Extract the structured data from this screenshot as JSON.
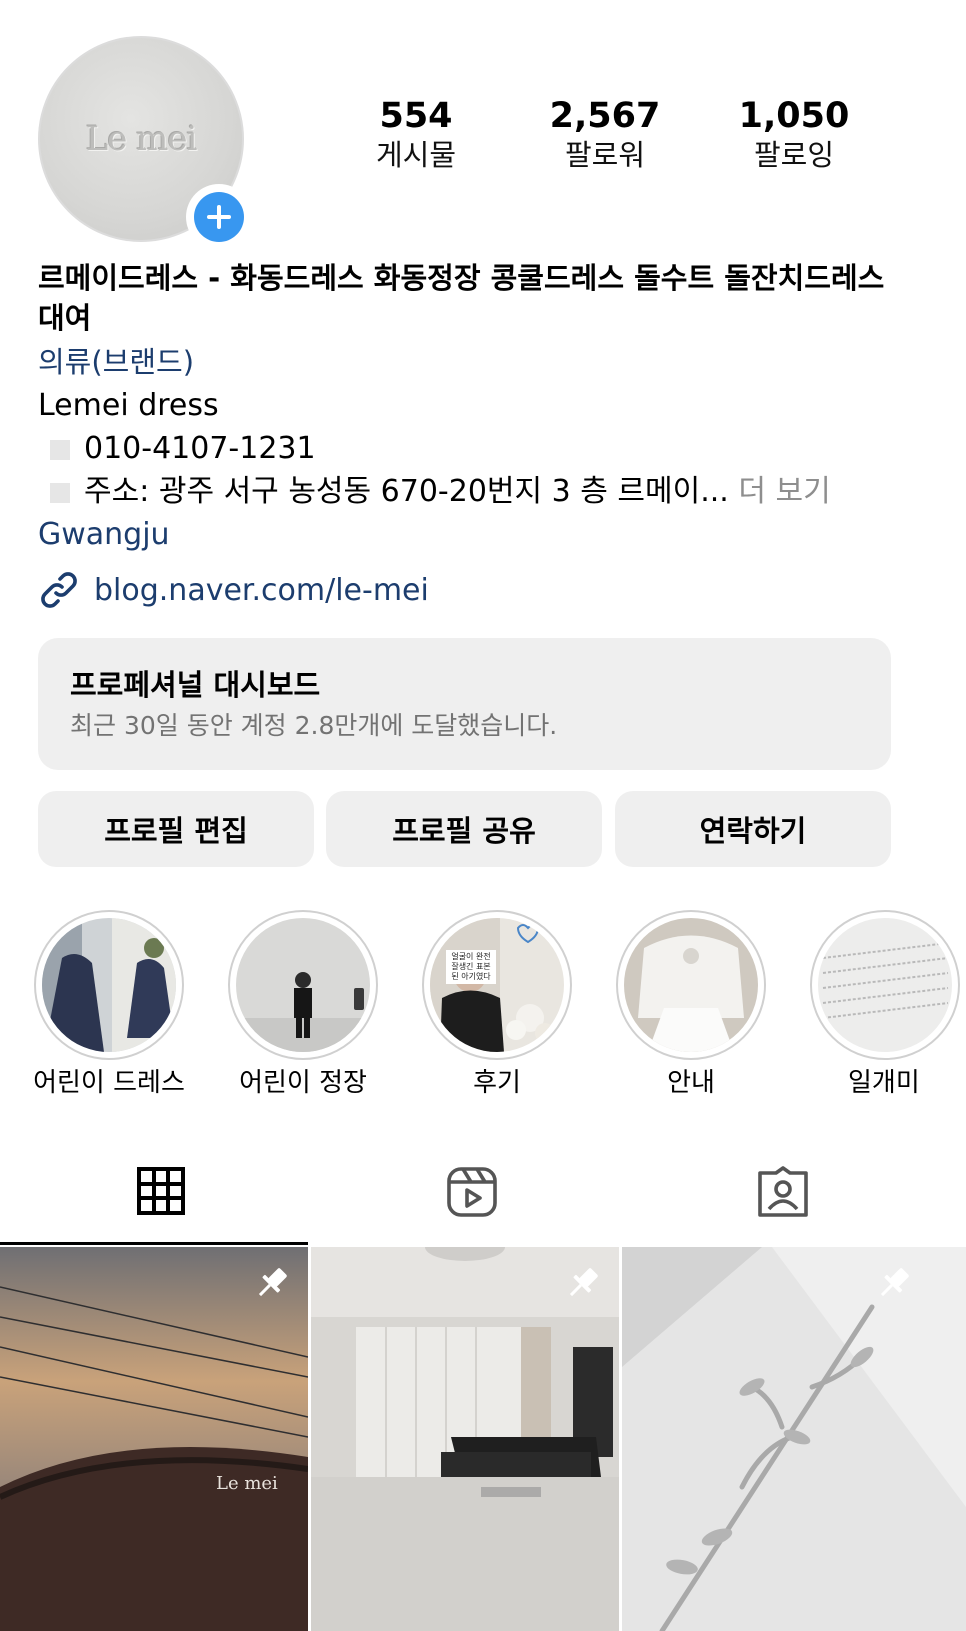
{
  "profile": {
    "avatar_logo": "Le mei",
    "stats": [
      {
        "value": "554",
        "label": "게시물"
      },
      {
        "value": "2,567",
        "label": "팔로워"
      },
      {
        "value": "1,050",
        "label": "팔로잉"
      }
    ],
    "name": "르메이드레스 - 화동드레스 화동정장 콩쿨드레스 돌수트 돌잔치드레스  대여",
    "category": "의류(브랜드)",
    "bio_title": "Lemei dress",
    "phone": "010-4107-1231",
    "address": "주소: 광주 서구 농성동 670-20번지 3 층 르메이...",
    "more_label": "더 보기",
    "location": "Gwangju",
    "link": "blog.naver.com/le-mei"
  },
  "dashboard": {
    "title": "프로페셔널 대시보드",
    "subtitle": "최근 30일 동안 계정 2.8만개에 도달했습니다."
  },
  "actions": {
    "edit_label": "프로필 편집",
    "share_label": "프로필 공유",
    "contact_label": "연락하기"
  },
  "highlights": [
    {
      "label": "어린이 드레스"
    },
    {
      "label": "어린이 정장"
    },
    {
      "label": "후기",
      "sticker_text": "얼굴이 완전 잘생긴 표본 된 아기였다"
    },
    {
      "label": "안내"
    },
    {
      "label": "일개미"
    }
  ],
  "tabs": [
    {
      "icon": "grid-icon",
      "active": true
    },
    {
      "icon": "reels-icon",
      "active": false
    },
    {
      "icon": "tagged-icon",
      "active": false
    }
  ],
  "posts": [
    {
      "pinned": true,
      "sign_text": "Le mei"
    },
    {
      "pinned": true
    },
    {
      "pinned": true
    }
  ],
  "colors": {
    "link": "#1c3d6e",
    "badge": "#3897f0",
    "button_bg": "#efefef"
  }
}
